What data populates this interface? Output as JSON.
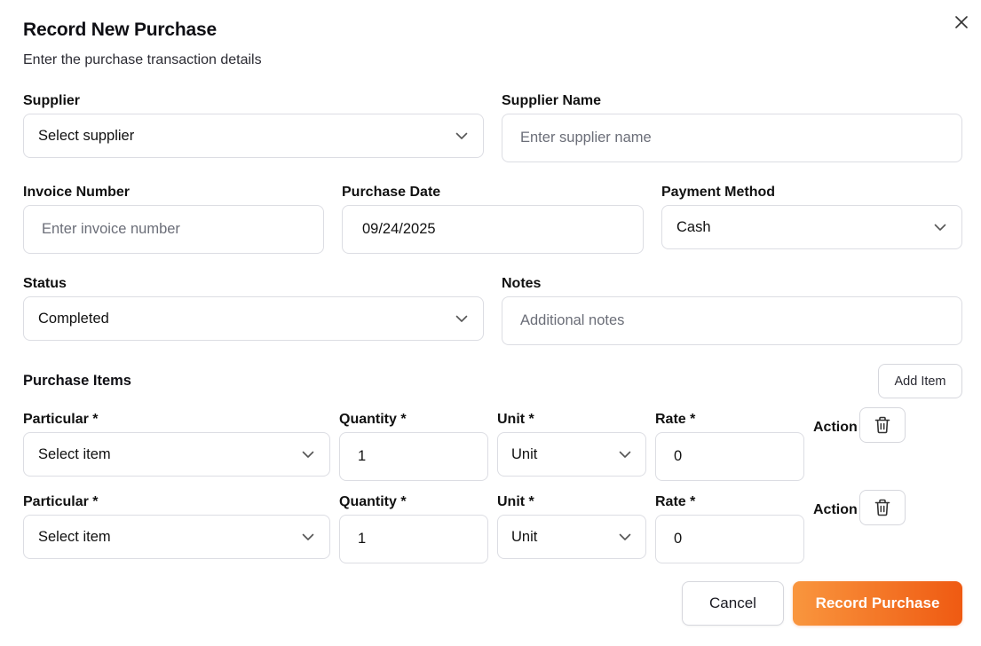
{
  "dialog": {
    "title": "Record New Purchase",
    "subtitle": "Enter the purchase transaction details",
    "close_icon": "close-icon"
  },
  "form": {
    "supplier": {
      "label": "Supplier",
      "value": "Select supplier"
    },
    "supplier_name": {
      "label": "Supplier Name",
      "placeholder": "Enter supplier name"
    },
    "invoice_number": {
      "label": "Invoice Number",
      "placeholder": "Enter invoice number"
    },
    "purchase_date": {
      "label": "Purchase Date",
      "value": "09/24/2025"
    },
    "payment_method": {
      "label": "Payment Method",
      "value": "Cash"
    },
    "status": {
      "label": "Status",
      "value": "Completed"
    },
    "notes": {
      "label": "Notes",
      "placeholder": "Additional notes"
    }
  },
  "items": {
    "title": "Purchase Items",
    "add_label": "Add Item",
    "rows": [
      {
        "particular_label": "Particular *",
        "particular_value": "Select item",
        "quantity_label": "Quantity *",
        "quantity_value": "1",
        "unit_label": "Unit *",
        "unit_value": "Unit",
        "rate_label": "Rate *",
        "rate_value": "0",
        "action_label": "Action",
        "delete_icon": "trash-icon"
      },
      {
        "particular_label": "Particular *",
        "particular_value": "Select item",
        "quantity_label": "Quantity *",
        "quantity_value": "1",
        "unit_label": "Unit *",
        "unit_value": "Unit",
        "rate_label": "Rate *",
        "rate_value": "0",
        "action_label": "Action",
        "delete_icon": "trash-icon"
      }
    ]
  },
  "footer": {
    "cancel_label": "Cancel",
    "submit_label": "Record Purchase"
  },
  "colors": {
    "primary_start": "#f9963e",
    "primary_end": "#ef5a12",
    "border": "#dcdde3",
    "placeholder": "#6b6e78"
  }
}
